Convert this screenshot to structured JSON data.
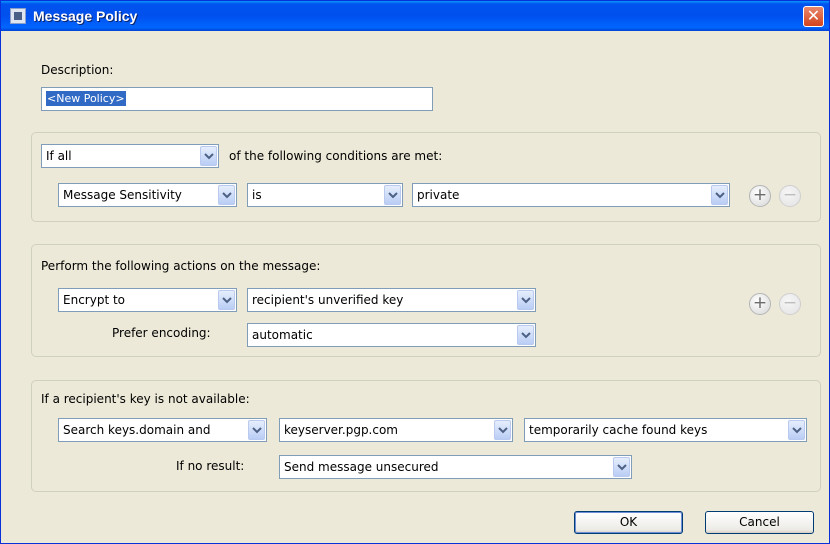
{
  "window": {
    "title": "Message Policy",
    "close_glyph": "✕"
  },
  "description": {
    "label": "Description:",
    "value": "<New Policy>"
  },
  "conditions": {
    "match_select": "If all",
    "match_text": "of the following conditions are met:",
    "rule": {
      "field": "Message Sensitivity",
      "operator": "is",
      "value": "private"
    }
  },
  "actions": {
    "heading": "Perform the following actions on the message:",
    "action_select": "Encrypt to",
    "action_value": "recipient's unverified key",
    "encoding_label": "Prefer encoding:",
    "encoding_value": "automatic"
  },
  "key_lookup": {
    "heading": "If a recipient's key is not available:",
    "search_select": "Search keys.domain and",
    "server_select": "keyserver.pgp.com",
    "cache_select": "temporarily cache found keys",
    "no_result_label": "If no result:",
    "no_result_value": "Send message unsecured"
  },
  "buttons": {
    "ok": "OK",
    "cancel": "Cancel"
  },
  "icons": {
    "add": "plus-icon",
    "remove": "minus-icon",
    "dropdown": "chevron-down-icon",
    "app": "policy-icon"
  },
  "colors": {
    "titlebar": "#0054e3",
    "close": "#d3441c",
    "selection": "#316ac5",
    "dialog": "#ece9d8"
  }
}
